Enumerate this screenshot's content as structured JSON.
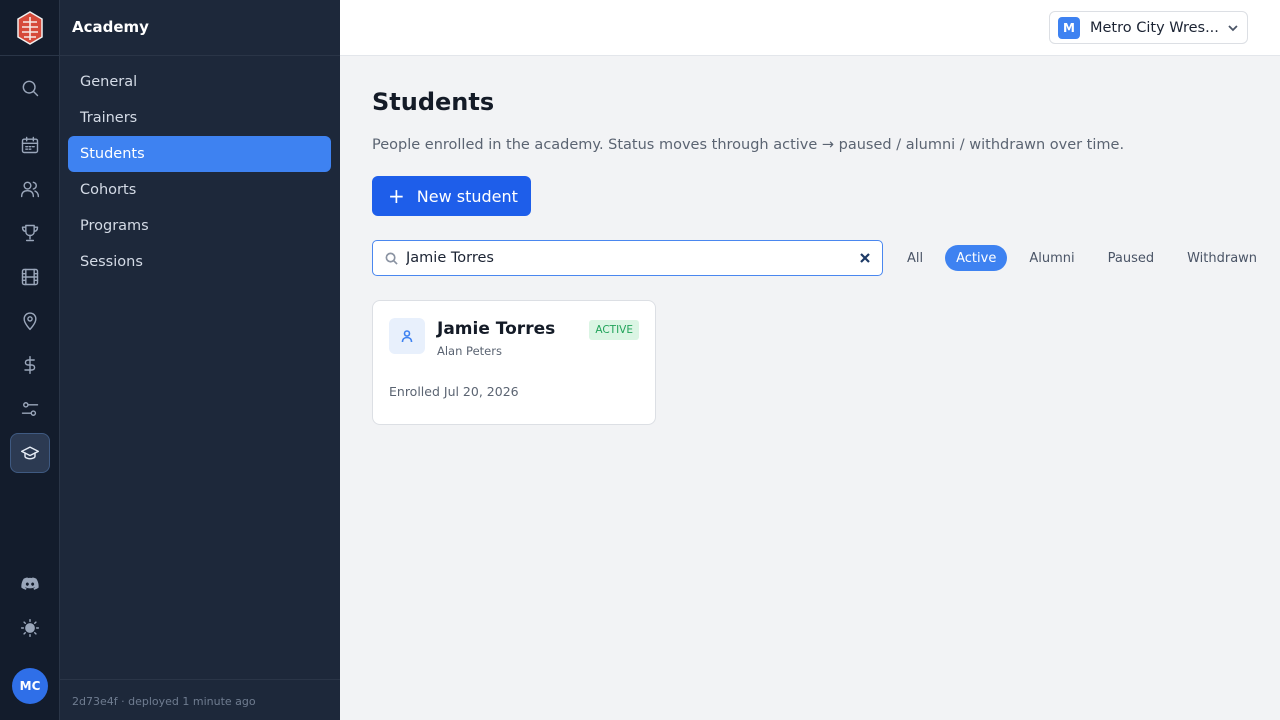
{
  "rail": {
    "icons": [
      "search-icon",
      "calendar-icon",
      "users-icon",
      "trophy-icon",
      "film-icon",
      "map-pin-icon",
      "dollar-icon",
      "sliders-icon",
      "graduation-cap-icon",
      "discord-icon",
      "sun-icon"
    ],
    "active": "graduation-cap-icon",
    "avatar_initials": "MC"
  },
  "subnav": {
    "title": "Academy",
    "items": [
      {
        "label": "General"
      },
      {
        "label": "Trainers"
      },
      {
        "label": "Students"
      },
      {
        "label": "Cohorts"
      },
      {
        "label": "Programs"
      },
      {
        "label": "Sessions"
      }
    ],
    "active": "Students",
    "commit": "2d73e4f",
    "deploy_text": "· deployed 1 minute ago"
  },
  "topbar": {
    "org_initial": "M",
    "org_name": "Metro City Wres..."
  },
  "main": {
    "title": "Students",
    "description": "People enrolled in the academy. Status moves through active → paused / alumni / withdrawn over time.",
    "new_button": "New student",
    "search": {
      "value": "Jamie Torres",
      "placeholder": ""
    },
    "filters": [
      "All",
      "Active",
      "Alumni",
      "Paused",
      "Withdrawn"
    ],
    "active_filter": "Active",
    "students": [
      {
        "name": "Jamie Torres",
        "trainer": "Alan Peters",
        "status": "ACTIVE",
        "enrolled": "Enrolled Jul 20, 2026"
      }
    ]
  },
  "colors": {
    "accent": "#3e82f1",
    "primary_button": "#1e5eea",
    "rail_bg": "#131c2c",
    "subnav_bg": "#1d283a",
    "status_active_bg": "#dbf5e4",
    "status_active_text": "#21a35a"
  }
}
